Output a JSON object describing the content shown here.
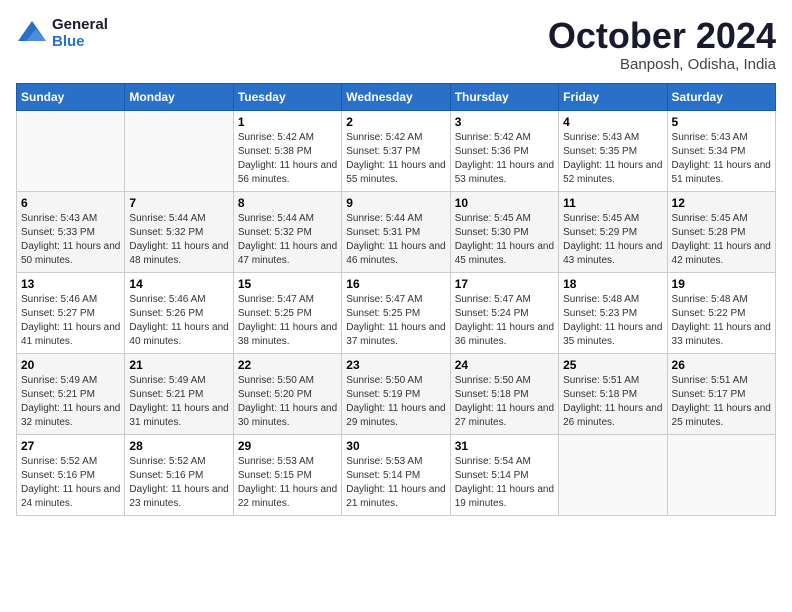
{
  "header": {
    "logo_line1": "General",
    "logo_line2": "Blue",
    "month": "October 2024",
    "location": "Banposh, Odisha, India"
  },
  "weekdays": [
    "Sunday",
    "Monday",
    "Tuesday",
    "Wednesday",
    "Thursday",
    "Friday",
    "Saturday"
  ],
  "weeks": [
    [
      {
        "day": "",
        "sunrise": "",
        "sunset": "",
        "daylight": ""
      },
      {
        "day": "",
        "sunrise": "",
        "sunset": "",
        "daylight": ""
      },
      {
        "day": "1",
        "sunrise": "Sunrise: 5:42 AM",
        "sunset": "Sunset: 5:38 PM",
        "daylight": "Daylight: 11 hours and 56 minutes."
      },
      {
        "day": "2",
        "sunrise": "Sunrise: 5:42 AM",
        "sunset": "Sunset: 5:37 PM",
        "daylight": "Daylight: 11 hours and 55 minutes."
      },
      {
        "day": "3",
        "sunrise": "Sunrise: 5:42 AM",
        "sunset": "Sunset: 5:36 PM",
        "daylight": "Daylight: 11 hours and 53 minutes."
      },
      {
        "day": "4",
        "sunrise": "Sunrise: 5:43 AM",
        "sunset": "Sunset: 5:35 PM",
        "daylight": "Daylight: 11 hours and 52 minutes."
      },
      {
        "day": "5",
        "sunrise": "Sunrise: 5:43 AM",
        "sunset": "Sunset: 5:34 PM",
        "daylight": "Daylight: 11 hours and 51 minutes."
      }
    ],
    [
      {
        "day": "6",
        "sunrise": "Sunrise: 5:43 AM",
        "sunset": "Sunset: 5:33 PM",
        "daylight": "Daylight: 11 hours and 50 minutes."
      },
      {
        "day": "7",
        "sunrise": "Sunrise: 5:44 AM",
        "sunset": "Sunset: 5:32 PM",
        "daylight": "Daylight: 11 hours and 48 minutes."
      },
      {
        "day": "8",
        "sunrise": "Sunrise: 5:44 AM",
        "sunset": "Sunset: 5:32 PM",
        "daylight": "Daylight: 11 hours and 47 minutes."
      },
      {
        "day": "9",
        "sunrise": "Sunrise: 5:44 AM",
        "sunset": "Sunset: 5:31 PM",
        "daylight": "Daylight: 11 hours and 46 minutes."
      },
      {
        "day": "10",
        "sunrise": "Sunrise: 5:45 AM",
        "sunset": "Sunset: 5:30 PM",
        "daylight": "Daylight: 11 hours and 45 minutes."
      },
      {
        "day": "11",
        "sunrise": "Sunrise: 5:45 AM",
        "sunset": "Sunset: 5:29 PM",
        "daylight": "Daylight: 11 hours and 43 minutes."
      },
      {
        "day": "12",
        "sunrise": "Sunrise: 5:45 AM",
        "sunset": "Sunset: 5:28 PM",
        "daylight": "Daylight: 11 hours and 42 minutes."
      }
    ],
    [
      {
        "day": "13",
        "sunrise": "Sunrise: 5:46 AM",
        "sunset": "Sunset: 5:27 PM",
        "daylight": "Daylight: 11 hours and 41 minutes."
      },
      {
        "day": "14",
        "sunrise": "Sunrise: 5:46 AM",
        "sunset": "Sunset: 5:26 PM",
        "daylight": "Daylight: 11 hours and 40 minutes."
      },
      {
        "day": "15",
        "sunrise": "Sunrise: 5:47 AM",
        "sunset": "Sunset: 5:25 PM",
        "daylight": "Daylight: 11 hours and 38 minutes."
      },
      {
        "day": "16",
        "sunrise": "Sunrise: 5:47 AM",
        "sunset": "Sunset: 5:25 PM",
        "daylight": "Daylight: 11 hours and 37 minutes."
      },
      {
        "day": "17",
        "sunrise": "Sunrise: 5:47 AM",
        "sunset": "Sunset: 5:24 PM",
        "daylight": "Daylight: 11 hours and 36 minutes."
      },
      {
        "day": "18",
        "sunrise": "Sunrise: 5:48 AM",
        "sunset": "Sunset: 5:23 PM",
        "daylight": "Daylight: 11 hours and 35 minutes."
      },
      {
        "day": "19",
        "sunrise": "Sunrise: 5:48 AM",
        "sunset": "Sunset: 5:22 PM",
        "daylight": "Daylight: 11 hours and 33 minutes."
      }
    ],
    [
      {
        "day": "20",
        "sunrise": "Sunrise: 5:49 AM",
        "sunset": "Sunset: 5:21 PM",
        "daylight": "Daylight: 11 hours and 32 minutes."
      },
      {
        "day": "21",
        "sunrise": "Sunrise: 5:49 AM",
        "sunset": "Sunset: 5:21 PM",
        "daylight": "Daylight: 11 hours and 31 minutes."
      },
      {
        "day": "22",
        "sunrise": "Sunrise: 5:50 AM",
        "sunset": "Sunset: 5:20 PM",
        "daylight": "Daylight: 11 hours and 30 minutes."
      },
      {
        "day": "23",
        "sunrise": "Sunrise: 5:50 AM",
        "sunset": "Sunset: 5:19 PM",
        "daylight": "Daylight: 11 hours and 29 minutes."
      },
      {
        "day": "24",
        "sunrise": "Sunrise: 5:50 AM",
        "sunset": "Sunset: 5:18 PM",
        "daylight": "Daylight: 11 hours and 27 minutes."
      },
      {
        "day": "25",
        "sunrise": "Sunrise: 5:51 AM",
        "sunset": "Sunset: 5:18 PM",
        "daylight": "Daylight: 11 hours and 26 minutes."
      },
      {
        "day": "26",
        "sunrise": "Sunrise: 5:51 AM",
        "sunset": "Sunset: 5:17 PM",
        "daylight": "Daylight: 11 hours and 25 minutes."
      }
    ],
    [
      {
        "day": "27",
        "sunrise": "Sunrise: 5:52 AM",
        "sunset": "Sunset: 5:16 PM",
        "daylight": "Daylight: 11 hours and 24 minutes."
      },
      {
        "day": "28",
        "sunrise": "Sunrise: 5:52 AM",
        "sunset": "Sunset: 5:16 PM",
        "daylight": "Daylight: 11 hours and 23 minutes."
      },
      {
        "day": "29",
        "sunrise": "Sunrise: 5:53 AM",
        "sunset": "Sunset: 5:15 PM",
        "daylight": "Daylight: 11 hours and 22 minutes."
      },
      {
        "day": "30",
        "sunrise": "Sunrise: 5:53 AM",
        "sunset": "Sunset: 5:14 PM",
        "daylight": "Daylight: 11 hours and 21 minutes."
      },
      {
        "day": "31",
        "sunrise": "Sunrise: 5:54 AM",
        "sunset": "Sunset: 5:14 PM",
        "daylight": "Daylight: 11 hours and 19 minutes."
      },
      {
        "day": "",
        "sunrise": "",
        "sunset": "",
        "daylight": ""
      },
      {
        "day": "",
        "sunrise": "",
        "sunset": "",
        "daylight": ""
      }
    ]
  ]
}
